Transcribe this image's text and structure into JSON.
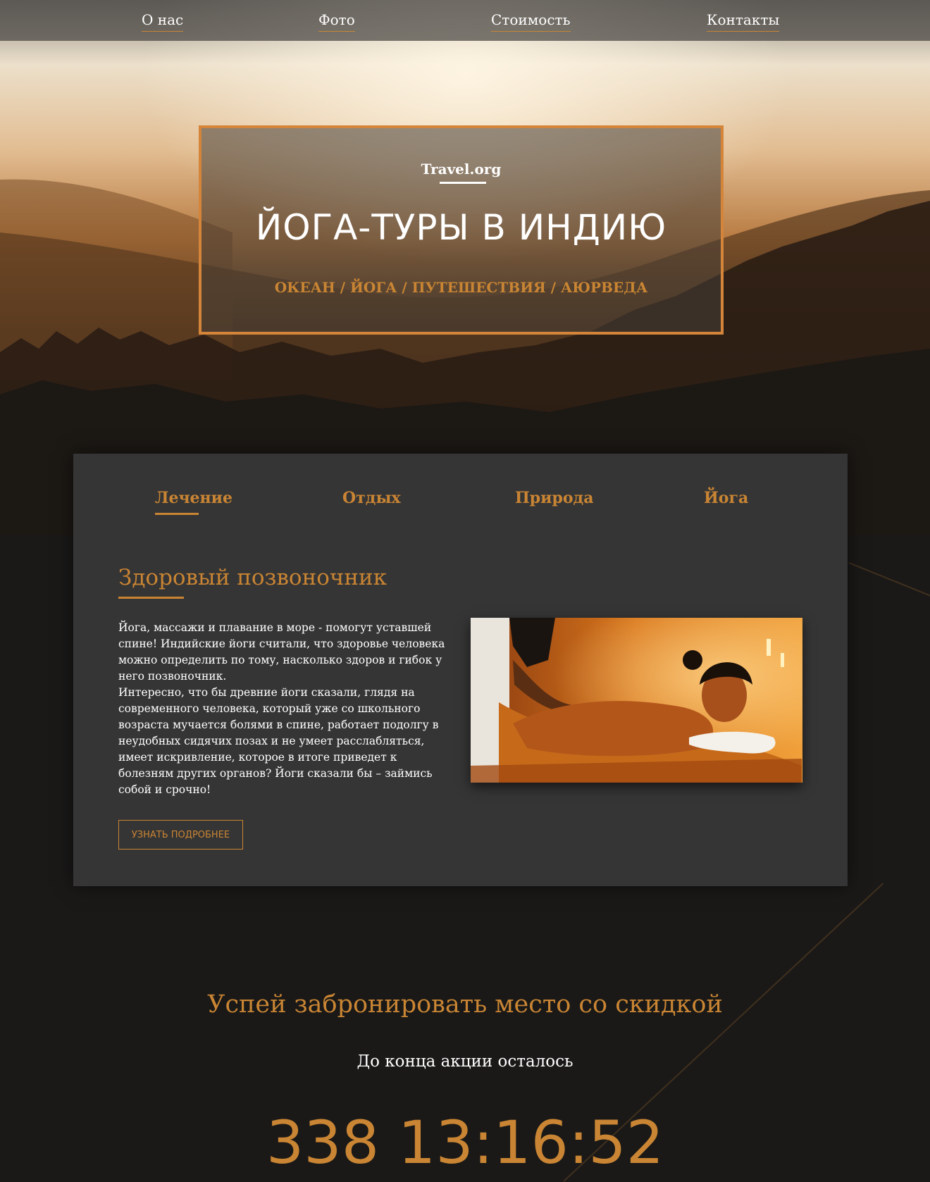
{
  "nav": {
    "items": [
      {
        "label": "О нас"
      },
      {
        "label": "Фото"
      },
      {
        "label": "Стоимость"
      },
      {
        "label": "Контакты"
      }
    ]
  },
  "hero": {
    "brand": "Travel.org",
    "title": "ЙОГА-ТУРЫ В ИНДИЮ",
    "tags": "ОКЕАН / ЙОГА / ПУТЕШЕСТВИЯ / АЮРВЕДА"
  },
  "tabs": [
    {
      "label": "Лечение",
      "active": true
    },
    {
      "label": "Отдых",
      "active": false
    },
    {
      "label": "Природа",
      "active": false
    },
    {
      "label": "Йога",
      "active": false
    }
  ],
  "section": {
    "title": "Здоровый позвоночник",
    "paragraph1": "Йога, массажи и плавание в море - помогут уставшей спине! Индийские йоги считали, что здоровье человека можно определить по тому, насколько здоров и гибок у него позвоночник.",
    "paragraph2": "Интересно, что бы древние йоги сказали, глядя на современного человека, который уже со школьного возраста мучается болями в спине, работает подолгу в неудобных сидячих позах и не умеет расслабляться, имеет искривление, которое в итоге приведет к болезням других органов? Йоги сказали бы – займись собой и срочно!",
    "button_label": "УЗНАТЬ ПОДРОБНЕЕ"
  },
  "promo": {
    "title": "Успей забронировать место со скидкой",
    "subtitle": "До конца акции осталось",
    "countdown": "338 13:16:52"
  },
  "colors": {
    "accent": "#c98533",
    "frame": "#d4853a",
    "panel": "#363535",
    "background": "#1a1918"
  }
}
